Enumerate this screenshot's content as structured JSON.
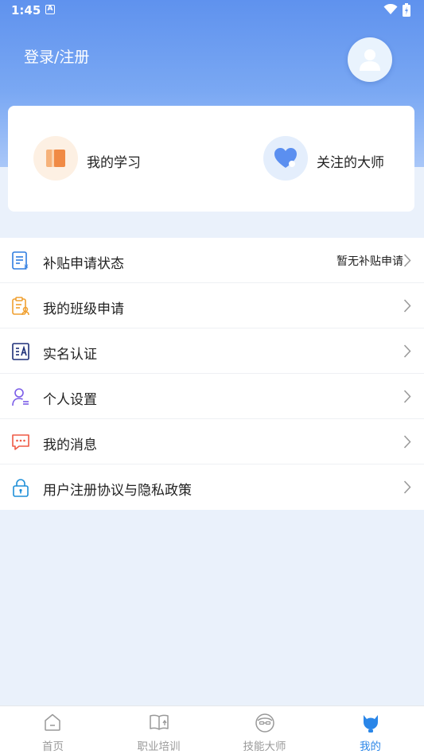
{
  "status_bar": {
    "time": "1:45",
    "notification_glyph": "A"
  },
  "header": {
    "login_label": "登录/注册",
    "avatar_icon": "user-icon"
  },
  "quick_links": [
    {
      "label": "我的学习",
      "icon": "book-icon",
      "color": "#f3a35e"
    },
    {
      "label": "关注的大师",
      "icon": "heart-icon",
      "color": "#5b8ff0"
    }
  ],
  "menu": [
    {
      "label": "补贴申请状态",
      "icon": "subsidy-doc-icon",
      "extra": "暂无补贴申请"
    },
    {
      "label": "我的班级申请",
      "icon": "clipboard-user-icon",
      "extra": ""
    },
    {
      "label": "实名认证",
      "icon": "id-card-icon",
      "extra": ""
    },
    {
      "label": "个人设置",
      "icon": "person-settings-icon",
      "extra": ""
    },
    {
      "label": "我的消息",
      "icon": "message-icon",
      "extra": ""
    },
    {
      "label": "用户注册协议与隐私政策",
      "icon": "lock-icon",
      "extra": ""
    }
  ],
  "tabbar": [
    {
      "label": "首页",
      "icon": "home-icon",
      "active": false
    },
    {
      "label": "职业培训",
      "icon": "open-book-icon",
      "active": false
    },
    {
      "label": "技能大师",
      "icon": "master-face-icon",
      "active": false
    },
    {
      "label": "我的",
      "icon": "mine-icon",
      "active": true
    }
  ],
  "colors": {
    "header_blue": "#5f92ee",
    "active_tab": "#2a86e8",
    "background": "#eaf1fb"
  }
}
